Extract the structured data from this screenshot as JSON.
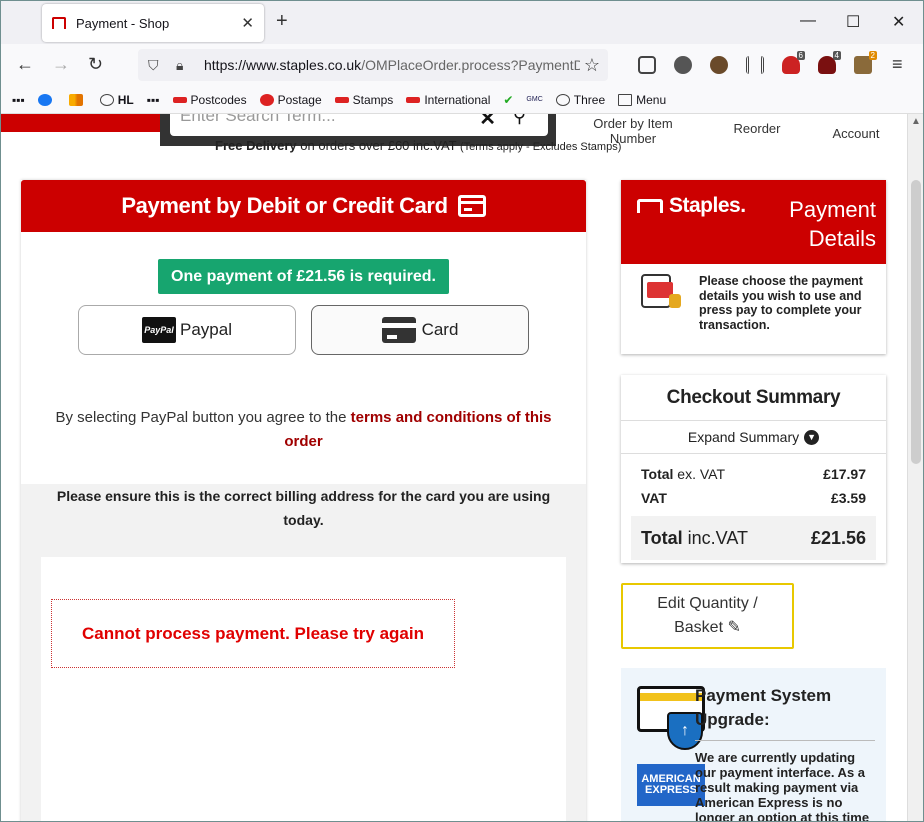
{
  "browser": {
    "tab_title": "Payment - Shop",
    "url_host": "https://www.staples.co.uk",
    "url_path": "/OMPlaceOrder.process?PaymentDe",
    "bookmarks": [
      "HL",
      "Postcodes",
      "Postage",
      "Stamps",
      "International",
      "GMC",
      "Three",
      "Menu"
    ],
    "extension_badges": [
      "6",
      "4",
      "2"
    ]
  },
  "header": {
    "search_placeholder": "Enter Search Term...",
    "order_by_item": "Order by Item Number",
    "reorder": "Reorder",
    "account": "Account",
    "free_delivery_bold": "Free Delivery",
    "free_delivery_text": " on orders over £60 inc.VAT ",
    "free_delivery_small": "(Terms apply - Excludes Stamps)"
  },
  "payment": {
    "heading": "Payment by Debit or Credit Card",
    "amount_required": "One payment of £21.56 is required.",
    "paypal_logo": "PayPal",
    "paypal_label": "Paypal",
    "card_label": "Card",
    "terms_prefix": "By selecting PayPal button you agree to the ",
    "terms_link": "terms and conditions of this order",
    "billing_note": "Please ensure this is the correct billing address for the card you are using today.",
    "error": "Cannot process payment. Please try again"
  },
  "payment_details": {
    "logo": "Staples.",
    "title_line1": "Payment",
    "title_line2": "Details",
    "instructions": "Please choose the payment details you wish to use and press pay to complete your transaction."
  },
  "checkout_summary": {
    "title": "Checkout Summary",
    "expand": "Expand Summary",
    "total_ex_label_bold": "Total",
    "total_ex_label": " ex. VAT",
    "total_ex_value": "£17.97",
    "vat_label": "VAT",
    "vat_value": "£3.59",
    "total_inc_label_bold": "Total",
    "total_inc_label": " inc.VAT",
    "total_inc_value": "£21.56"
  },
  "edit_button": {
    "line1": "Edit Quantity /",
    "line2": "Basket"
  },
  "upgrade": {
    "title": "Payment System Upgrade:",
    "amex": "AMERICAN EXPRESS",
    "body": "We are currently updating our payment interface. As a result making payment via American Express is no longer an option at this time"
  },
  "colors": {
    "brand_red": "#cc0000",
    "success_green": "#17a56f",
    "error_red": "#e00000",
    "edit_border": "#e8c800"
  }
}
